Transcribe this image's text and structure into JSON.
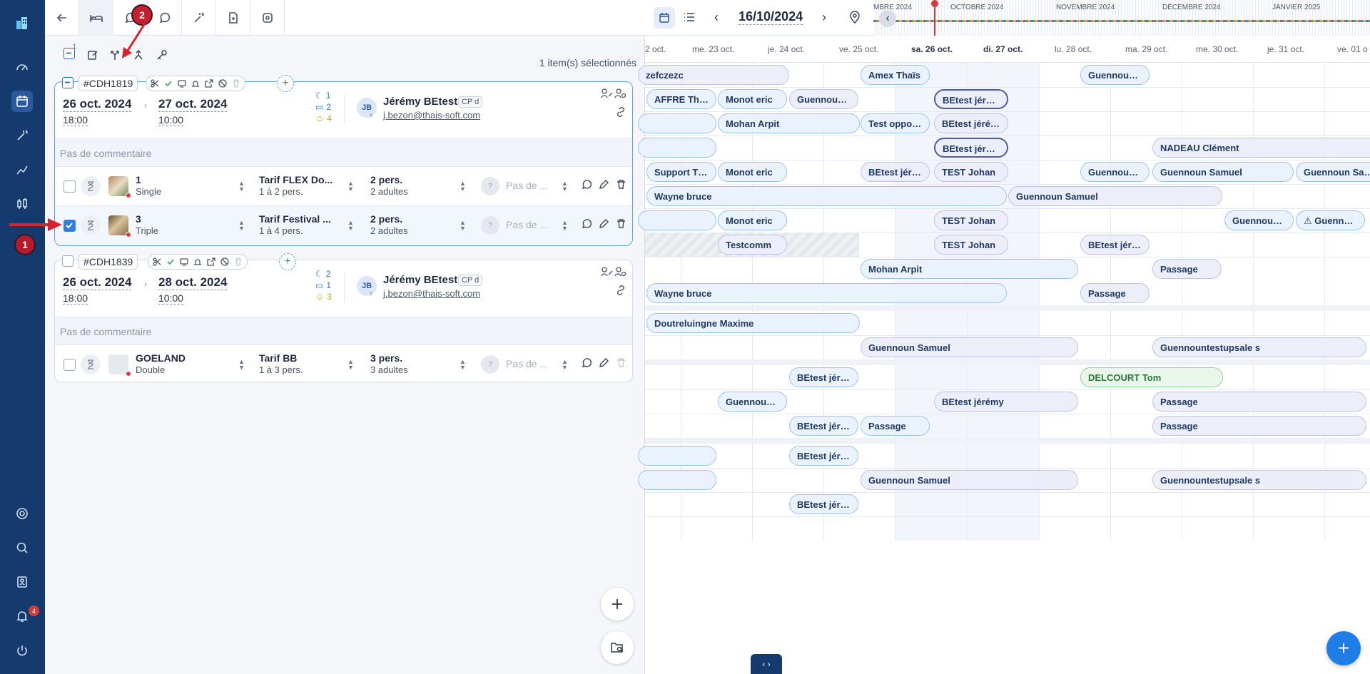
{
  "sidebar": {
    "badge_number": "1",
    "notifications_count": "4"
  },
  "toolbar": {
    "annotation_number": "2"
  },
  "actions": {
    "selected_count_badge": "1",
    "selected_text": "1 item(s) sélectionnés"
  },
  "bookings": [
    {
      "id": "#CDH1819",
      "start_date": "26 oct. 2024",
      "start_time": "18:00",
      "end_date": "27 oct. 2024",
      "end_time": "10:00",
      "nights": "1",
      "rooms": "2",
      "persons": "4",
      "avatar": "JB",
      "avatar_lang": "fr",
      "guest": "Jérémy BEtest",
      "guest_tag": "CP d",
      "email": "j.bezon@thais-soft.com",
      "comment": "Pas de commentaire",
      "rooms_list": [
        {
          "room": "1",
          "type": "Single",
          "rate": "Tarif FLEX Do...",
          "rate_sub": "1 à 2 pers.",
          "pers": "2 pers.",
          "pers_sub": "2 adultes",
          "placeholder": "Pas de ...",
          "checked": false
        },
        {
          "room": "3",
          "type": "Triple",
          "rate": "Tarif Festival ...",
          "rate_sub": "1 à 4 pers.",
          "pers": "2 pers.",
          "pers_sub": "2 adultes",
          "placeholder": "Pas de ...",
          "checked": true
        }
      ]
    },
    {
      "id": "#CDH1839",
      "start_date": "26 oct. 2024",
      "start_time": "18:00",
      "end_date": "28 oct. 2024",
      "end_time": "10:00",
      "nights": "2",
      "rooms": "1",
      "persons": "3",
      "avatar": "JB",
      "avatar_lang": "fr",
      "guest": "Jérémy BEtest",
      "guest_tag": "CP d",
      "email": "j.bezon@thais-soft.com",
      "comment": "Pas de commentaire",
      "rooms_list": [
        {
          "room": "GOELAND",
          "type": "Double",
          "rate": "Tarif BB",
          "rate_sub": "1 à 3 pers.",
          "pers": "3 pers.",
          "pers_sub": "3 adultes",
          "placeholder": "Pas de ...",
          "checked": false
        }
      ]
    }
  ],
  "planning": {
    "current_date": "16/10/2024",
    "months": [
      "MBRE 2024",
      "OCTOBRE 2024",
      "NOVEMBRE 2024",
      "DÉCEMBRE 2024",
      "JANVIER 2025"
    ],
    "days": [
      "2 oct.",
      "me. 23 oct.",
      "je. 24 oct.",
      "ve. 25 oct.",
      "sa. 26 oct.",
      "di. 27 oct.",
      "lu. 28 oct.",
      "ma. 29 oct.",
      "me. 30 oct.",
      "je. 31 oct.",
      "ve. 01 o"
    ],
    "reservations": [
      {
        "label": "zefczezc"
      },
      {
        "label": "Amex Thaïs"
      },
      {
        "label": "Guennoun ..."
      },
      {
        "label": "AFFRE Thib..."
      },
      {
        "label": "Monot eric"
      },
      {
        "label": "Guennoun ..."
      },
      {
        "label": "BEtest jérémy"
      },
      {
        "label": "Mohan Arpit"
      },
      {
        "label": "Test opposi..."
      },
      {
        "label": "BEtest jérémy"
      },
      {
        "label": "BEtest jérémy"
      },
      {
        "label": "NADEAU Clément"
      },
      {
        "label": "Support Th..."
      },
      {
        "label": "Monot eric"
      },
      {
        "label": "BEtest jéré..."
      },
      {
        "label": "TEST Johan"
      },
      {
        "label": "Guennoun ..."
      },
      {
        "label": "Guennoun Samuel"
      },
      {
        "label": "Guennoun Samu"
      },
      {
        "label": "Wayne bruce"
      },
      {
        "label": "Guennoun Samuel"
      },
      {
        "label": "Monot eric"
      },
      {
        "label": "TEST Johan"
      },
      {
        "label": "Guennoun ..."
      },
      {
        "label": "⚠ Guenno..."
      },
      {
        "label": "Testcomm"
      },
      {
        "label": "TEST Johan"
      },
      {
        "label": "BEtest jéré..."
      },
      {
        "label": "Mohan Arpit"
      },
      {
        "label": "Passage"
      },
      {
        "label": "Wayne bruce"
      },
      {
        "label": "Passage"
      },
      {
        "label": "Doutreluingne Maxime"
      },
      {
        "label": "Guennoun Samuel"
      },
      {
        "label": "Guennountestupsale s"
      },
      {
        "label": "BEtest jéré..."
      },
      {
        "label": "DELCOURT Tom"
      },
      {
        "label": "Guennoun ..."
      },
      {
        "label": "BEtest jérémy"
      },
      {
        "label": "Passage"
      },
      {
        "label": "BEtest jéré..."
      },
      {
        "label": "Passage"
      },
      {
        "label": "Passage"
      },
      {
        "label": "BEtest jéré..."
      },
      {
        "label": "Guennoun Samuel"
      },
      {
        "label": "Guennountestupsale s"
      },
      {
        "label": "BEtest jéré..."
      }
    ]
  },
  "colors": {
    "sidebar": "#153a6e",
    "accent": "#1e7ee6",
    "annotation_red": "#c6202f"
  }
}
